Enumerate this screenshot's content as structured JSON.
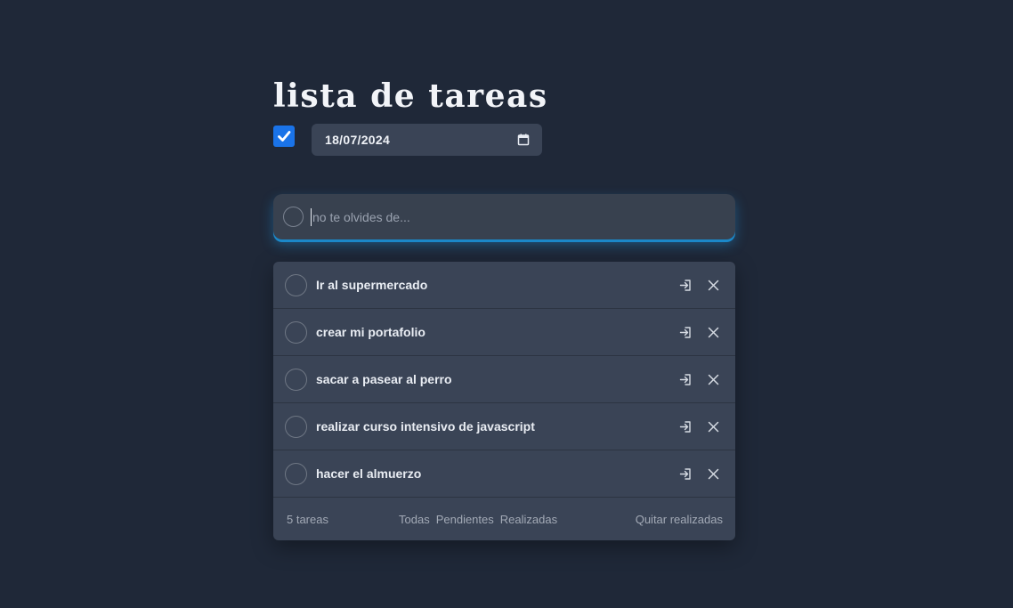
{
  "header": {
    "title": "lista de tareas"
  },
  "controls": {
    "toggle_checked": true,
    "date_value": "18/07/2024"
  },
  "new_task": {
    "placeholder": "no te olvides de..."
  },
  "tasks": [
    {
      "text": "Ir al supermercado",
      "completed": false
    },
    {
      "text": "crear mi portafolio",
      "completed": false
    },
    {
      "text": "sacar a pasear al perro",
      "completed": false
    },
    {
      "text": "realizar curso intensivo de javascript",
      "completed": false
    },
    {
      "text": "hacer el almuerzo",
      "completed": false
    }
  ],
  "footer": {
    "count": "5 tareas",
    "filters": [
      "Todas",
      "Pendientes",
      "Realizadas"
    ],
    "clear": "Quitar realizadas"
  },
  "icons": {
    "task_actions": [
      "edit-icon",
      "close-icon"
    ],
    "date_picker": "calendar-icon"
  },
  "colors": {
    "background": "#1f2838",
    "card": "#3a4456",
    "accent_blue": "#1a73e8",
    "input_glow": "#1b88c9"
  }
}
